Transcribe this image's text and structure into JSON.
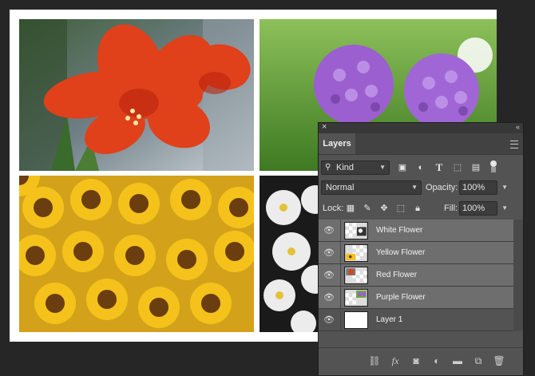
{
  "panel": {
    "close_glyph": "×",
    "collapse_glyph": "‹‹",
    "tab_label": "Layers",
    "filter": {
      "value": "Kind",
      "icon": "search-icon"
    },
    "filter_icons": [
      "image-filter-icon",
      "adjustment-filter-icon",
      "type-filter-icon",
      "shape-filter-icon",
      "smart-object-filter-icon",
      "filter-toggle-icon"
    ],
    "blend_mode": "Normal",
    "opacity_label": "Opacity:",
    "opacity_value": "100%",
    "lock_label": "Lock:",
    "fill_label": "Fill:",
    "fill_value": "100%",
    "layers": [
      {
        "name": "White Flower",
        "selected": true
      },
      {
        "name": "Yellow Flower",
        "selected": true
      },
      {
        "name": "Red Flower",
        "selected": true
      },
      {
        "name": "Purple Flower",
        "selected": true
      },
      {
        "name": "Layer 1",
        "selected": false
      }
    ],
    "footer_icons": [
      "link-layers-icon",
      "fx-icon",
      "layer-mask-icon",
      "adjustment-layer-icon",
      "group-folder-icon",
      "new-layer-icon",
      "trash-icon"
    ],
    "fx_label": "fx"
  },
  "colors": {
    "background": "#262626",
    "panel": "#535353",
    "selected_row": "#6e6e6e",
    "red_flower": "#e0401a",
    "purple_flower": "#9b5fd0",
    "sunflower": "#f4c21b"
  }
}
